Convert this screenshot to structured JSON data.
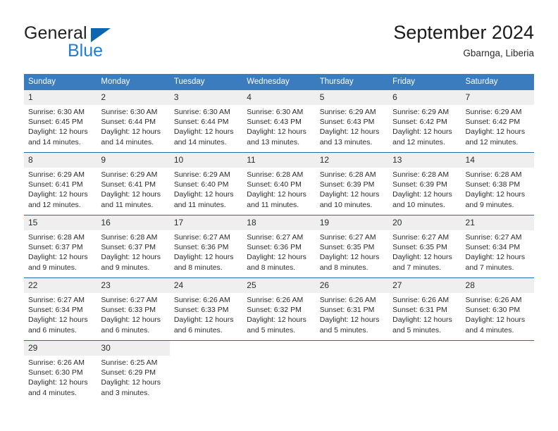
{
  "brand": {
    "name_top": "General",
    "name_bottom": "Blue",
    "triangle_color": "#0a66b0",
    "blue_text_color": "#1c7fd4"
  },
  "header": {
    "title": "September 2024",
    "subtitle": "Gbarnga, Liberia"
  },
  "theme": {
    "header_blue": "#3a7cbd",
    "row_divider_blue": "#1f6cb0",
    "daynum_band": "#efefef"
  },
  "calendar": {
    "weekday_headers": [
      "Sunday",
      "Monday",
      "Tuesday",
      "Wednesday",
      "Thursday",
      "Friday",
      "Saturday"
    ],
    "weeks": [
      [
        {
          "day": "1",
          "sunrise": "Sunrise: 6:30 AM",
          "sunset": "Sunset: 6:45 PM",
          "daylight_line1": "Daylight: 12 hours",
          "daylight_line2": "and 14 minutes."
        },
        {
          "day": "2",
          "sunrise": "Sunrise: 6:30 AM",
          "sunset": "Sunset: 6:44 PM",
          "daylight_line1": "Daylight: 12 hours",
          "daylight_line2": "and 14 minutes."
        },
        {
          "day": "3",
          "sunrise": "Sunrise: 6:30 AM",
          "sunset": "Sunset: 6:44 PM",
          "daylight_line1": "Daylight: 12 hours",
          "daylight_line2": "and 14 minutes."
        },
        {
          "day": "4",
          "sunrise": "Sunrise: 6:30 AM",
          "sunset": "Sunset: 6:43 PM",
          "daylight_line1": "Daylight: 12 hours",
          "daylight_line2": "and 13 minutes."
        },
        {
          "day": "5",
          "sunrise": "Sunrise: 6:29 AM",
          "sunset": "Sunset: 6:43 PM",
          "daylight_line1": "Daylight: 12 hours",
          "daylight_line2": "and 13 minutes."
        },
        {
          "day": "6",
          "sunrise": "Sunrise: 6:29 AM",
          "sunset": "Sunset: 6:42 PM",
          "daylight_line1": "Daylight: 12 hours",
          "daylight_line2": "and 12 minutes."
        },
        {
          "day": "7",
          "sunrise": "Sunrise: 6:29 AM",
          "sunset": "Sunset: 6:42 PM",
          "daylight_line1": "Daylight: 12 hours",
          "daylight_line2": "and 12 minutes."
        }
      ],
      [
        {
          "day": "8",
          "sunrise": "Sunrise: 6:29 AM",
          "sunset": "Sunset: 6:41 PM",
          "daylight_line1": "Daylight: 12 hours",
          "daylight_line2": "and 12 minutes."
        },
        {
          "day": "9",
          "sunrise": "Sunrise: 6:29 AM",
          "sunset": "Sunset: 6:41 PM",
          "daylight_line1": "Daylight: 12 hours",
          "daylight_line2": "and 11 minutes."
        },
        {
          "day": "10",
          "sunrise": "Sunrise: 6:29 AM",
          "sunset": "Sunset: 6:40 PM",
          "daylight_line1": "Daylight: 12 hours",
          "daylight_line2": "and 11 minutes."
        },
        {
          "day": "11",
          "sunrise": "Sunrise: 6:28 AM",
          "sunset": "Sunset: 6:40 PM",
          "daylight_line1": "Daylight: 12 hours",
          "daylight_line2": "and 11 minutes."
        },
        {
          "day": "12",
          "sunrise": "Sunrise: 6:28 AM",
          "sunset": "Sunset: 6:39 PM",
          "daylight_line1": "Daylight: 12 hours",
          "daylight_line2": "and 10 minutes."
        },
        {
          "day": "13",
          "sunrise": "Sunrise: 6:28 AM",
          "sunset": "Sunset: 6:39 PM",
          "daylight_line1": "Daylight: 12 hours",
          "daylight_line2": "and 10 minutes."
        },
        {
          "day": "14",
          "sunrise": "Sunrise: 6:28 AM",
          "sunset": "Sunset: 6:38 PM",
          "daylight_line1": "Daylight: 12 hours",
          "daylight_line2": "and 9 minutes."
        }
      ],
      [
        {
          "day": "15",
          "sunrise": "Sunrise: 6:28 AM",
          "sunset": "Sunset: 6:37 PM",
          "daylight_line1": "Daylight: 12 hours",
          "daylight_line2": "and 9 minutes."
        },
        {
          "day": "16",
          "sunrise": "Sunrise: 6:28 AM",
          "sunset": "Sunset: 6:37 PM",
          "daylight_line1": "Daylight: 12 hours",
          "daylight_line2": "and 9 minutes."
        },
        {
          "day": "17",
          "sunrise": "Sunrise: 6:27 AM",
          "sunset": "Sunset: 6:36 PM",
          "daylight_line1": "Daylight: 12 hours",
          "daylight_line2": "and 8 minutes."
        },
        {
          "day": "18",
          "sunrise": "Sunrise: 6:27 AM",
          "sunset": "Sunset: 6:36 PM",
          "daylight_line1": "Daylight: 12 hours",
          "daylight_line2": "and 8 minutes."
        },
        {
          "day": "19",
          "sunrise": "Sunrise: 6:27 AM",
          "sunset": "Sunset: 6:35 PM",
          "daylight_line1": "Daylight: 12 hours",
          "daylight_line2": "and 8 minutes."
        },
        {
          "day": "20",
          "sunrise": "Sunrise: 6:27 AM",
          "sunset": "Sunset: 6:35 PM",
          "daylight_line1": "Daylight: 12 hours",
          "daylight_line2": "and 7 minutes."
        },
        {
          "day": "21",
          "sunrise": "Sunrise: 6:27 AM",
          "sunset": "Sunset: 6:34 PM",
          "daylight_line1": "Daylight: 12 hours",
          "daylight_line2": "and 7 minutes."
        }
      ],
      [
        {
          "day": "22",
          "sunrise": "Sunrise: 6:27 AM",
          "sunset": "Sunset: 6:34 PM",
          "daylight_line1": "Daylight: 12 hours",
          "daylight_line2": "and 6 minutes."
        },
        {
          "day": "23",
          "sunrise": "Sunrise: 6:27 AM",
          "sunset": "Sunset: 6:33 PM",
          "daylight_line1": "Daylight: 12 hours",
          "daylight_line2": "and 6 minutes."
        },
        {
          "day": "24",
          "sunrise": "Sunrise: 6:26 AM",
          "sunset": "Sunset: 6:33 PM",
          "daylight_line1": "Daylight: 12 hours",
          "daylight_line2": "and 6 minutes."
        },
        {
          "day": "25",
          "sunrise": "Sunrise: 6:26 AM",
          "sunset": "Sunset: 6:32 PM",
          "daylight_line1": "Daylight: 12 hours",
          "daylight_line2": "and 5 minutes."
        },
        {
          "day": "26",
          "sunrise": "Sunrise: 6:26 AM",
          "sunset": "Sunset: 6:31 PM",
          "daylight_line1": "Daylight: 12 hours",
          "daylight_line2": "and 5 minutes."
        },
        {
          "day": "27",
          "sunrise": "Sunrise: 6:26 AM",
          "sunset": "Sunset: 6:31 PM",
          "daylight_line1": "Daylight: 12 hours",
          "daylight_line2": "and 5 minutes."
        },
        {
          "day": "28",
          "sunrise": "Sunrise: 6:26 AM",
          "sunset": "Sunset: 6:30 PM",
          "daylight_line1": "Daylight: 12 hours",
          "daylight_line2": "and 4 minutes."
        }
      ],
      [
        {
          "day": "29",
          "sunrise": "Sunrise: 6:26 AM",
          "sunset": "Sunset: 6:30 PM",
          "daylight_line1": "Daylight: 12 hours",
          "daylight_line2": "and 4 minutes."
        },
        {
          "day": "30",
          "sunrise": "Sunrise: 6:25 AM",
          "sunset": "Sunset: 6:29 PM",
          "daylight_line1": "Daylight: 12 hours",
          "daylight_line2": "and 3 minutes."
        },
        {
          "day": "",
          "sunrise": "",
          "sunset": "",
          "daylight_line1": "",
          "daylight_line2": ""
        },
        {
          "day": "",
          "sunrise": "",
          "sunset": "",
          "daylight_line1": "",
          "daylight_line2": ""
        },
        {
          "day": "",
          "sunrise": "",
          "sunset": "",
          "daylight_line1": "",
          "daylight_line2": ""
        },
        {
          "day": "",
          "sunrise": "",
          "sunset": "",
          "daylight_line1": "",
          "daylight_line2": ""
        },
        {
          "day": "",
          "sunrise": "",
          "sunset": "",
          "daylight_line1": "",
          "daylight_line2": ""
        }
      ]
    ]
  }
}
